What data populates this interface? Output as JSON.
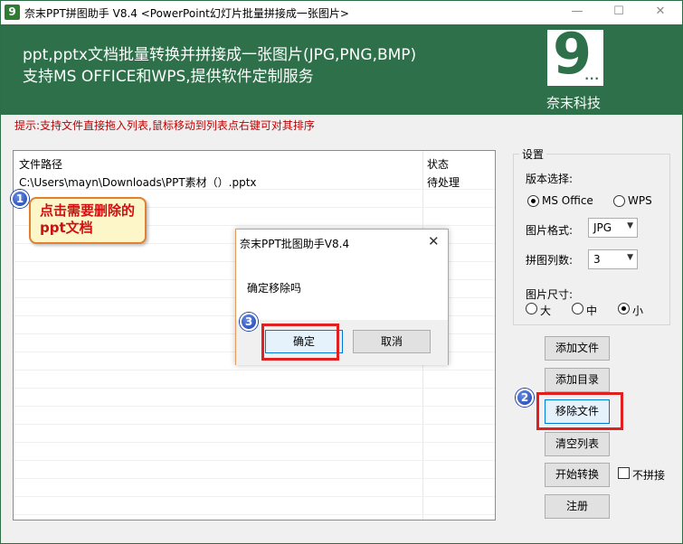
{
  "window": {
    "title": "奈末PPT拼图助手 V8.4 <PowerPoint幻灯片批量拼接成一张图片>",
    "app_icon_glyph": "9",
    "controls": {
      "minimize": "—",
      "maximize": "☐",
      "close": "✕"
    }
  },
  "banner": {
    "line1": "ppt,pptx文档批量转换并拼接成一张图片(JPG,PNG,BMP)",
    "line2": "支持MS OFFICE和WPS,提供软件定制服务",
    "logo_glyph": "9",
    "logo_dots": "...",
    "logo_caption": "奈末科技",
    "bg_color": "#2d7049"
  },
  "hint": "提示:支持文件直接拖入列表,鼠标移动到列表点右键可对其排序",
  "file_table": {
    "headers": {
      "path": "文件路径",
      "status": "状态"
    },
    "rows": [
      {
        "path": "C:\\Users\\mayn\\Downloads\\PPT素材（）.pptx",
        "status": "待处理"
      }
    ]
  },
  "annotations": {
    "step1_badge": "1",
    "step1_text": "点击需要删除的ppt文档",
    "step2_badge": "2",
    "step3_badge": "3",
    "highlight_color": "#e02020"
  },
  "settings": {
    "title": "设置",
    "version_label": "版本选择:",
    "version_options": [
      "MS Office",
      "WPS"
    ],
    "version_selected": "MS Office",
    "format_label": "图片格式:",
    "format_value": "JPG",
    "columns_label": "拼图列数:",
    "columns_value": "3",
    "size_label": "图片尺寸:",
    "size_options": [
      "大",
      "中",
      "小"
    ],
    "size_selected": "小"
  },
  "actions": {
    "add_file": "添加文件",
    "add_folder": "添加目录",
    "remove_file": "移除文件",
    "clear_list": "清空列表",
    "start_convert": "开始转换",
    "no_stitch": "不拼接",
    "register": "注册"
  },
  "dialog": {
    "title": "奈末PPT批图助手V8.4",
    "close_glyph": "✕",
    "message": "确定移除吗",
    "ok": "确定",
    "cancel": "取消"
  }
}
